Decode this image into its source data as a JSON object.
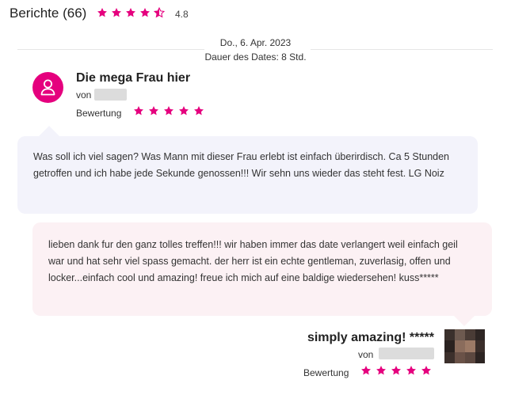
{
  "header": {
    "title": "Berichte (66)",
    "rating": "4.8",
    "stars": [
      1,
      1,
      1,
      1,
      0.5
    ]
  },
  "date_block": {
    "date": "Do., 6. Apr. 2023",
    "duration": "Dauer des Dates: 8 Std."
  },
  "review": {
    "title": "Die mega Frau hier",
    "by_label": "von",
    "rating_label": "Bewertung",
    "stars": 5,
    "text": "Was soll ich viel sagen? Was Mann mit dieser Frau erlebt ist einfach überirdisch. Ca 5 Stunden getroffen und ich habe jede Sekunde genossen!!! Wir sehn uns wieder das steht fest. LG Noiz"
  },
  "reply": {
    "text": "lieben dank fur den ganz tolles treffen!!! wir haben immer das date verlangert weil einfach geil war und hat sehr viel spass gemacht. der herr ist ein echte gentleman, zuverlasig, offen und locker...einfach cool und amazing! freue ich mich auf eine baldige wiedersehen! kuss*****",
    "title": "simply amazing! *****",
    "by_label": "von",
    "rating_label": "Bewertung",
    "stars": 5
  },
  "colors": {
    "accent": "#e5007e",
    "review_bubble": "#f3f3fb",
    "reply_bubble": "#fcf1f4"
  },
  "icons": {
    "star": "star-icon",
    "half_star": "star-half-icon",
    "avatar": "user-icon"
  }
}
